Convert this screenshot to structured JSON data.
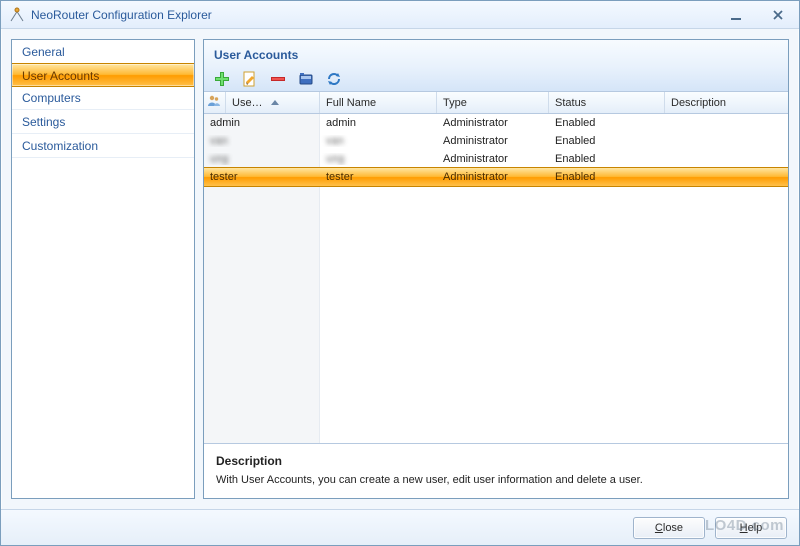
{
  "window": {
    "title": "NeoRouter Configuration Explorer"
  },
  "sidebar": {
    "items": [
      {
        "label": "General",
        "selected": false
      },
      {
        "label": "User Accounts",
        "selected": true
      },
      {
        "label": "Computers",
        "selected": false
      },
      {
        "label": "Settings",
        "selected": false
      },
      {
        "label": "Customization",
        "selected": false
      }
    ]
  },
  "panel": {
    "title": "User Accounts",
    "toolbar": {
      "add": "add-user",
      "edit": "edit-user",
      "remove": "remove-user",
      "properties": "properties",
      "refresh": "refresh"
    },
    "columns": [
      {
        "label": "Use…",
        "sort": "asc"
      },
      {
        "label": "Full Name"
      },
      {
        "label": "Type"
      },
      {
        "label": "Status"
      },
      {
        "label": "Description"
      }
    ],
    "rows": [
      {
        "user": "admin",
        "fullName": "admin",
        "type": "Administrator",
        "status": "Enabled",
        "description": "",
        "selected": false,
        "blurred": false
      },
      {
        "user": "van",
        "fullName": "van",
        "type": "Administrator",
        "status": "Enabled",
        "description": "",
        "selected": false,
        "blurred": true
      },
      {
        "user": "ung",
        "fullName": "ung",
        "type": "Administrator",
        "status": "Enabled",
        "description": "",
        "selected": false,
        "blurred": true
      },
      {
        "user": "tester",
        "fullName": "tester",
        "type": "Administrator",
        "status": "Enabled",
        "description": "",
        "selected": true,
        "blurred": false
      }
    ],
    "description": {
      "title": "Description",
      "text": "With User Accounts, you can create a new user, edit user information and delete a user."
    }
  },
  "footer": {
    "close": "Close",
    "help": "Help"
  },
  "watermark": "LO4D.com"
}
